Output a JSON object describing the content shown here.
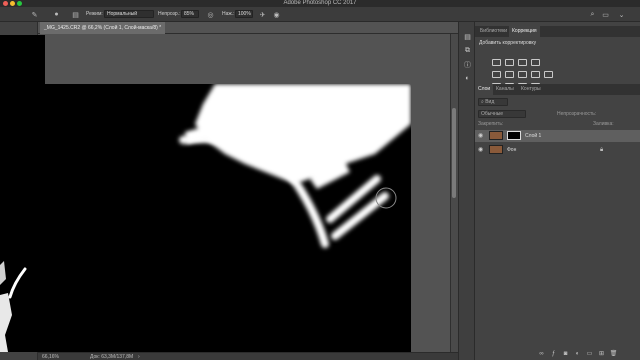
{
  "window": {
    "title": "Adobe Photoshop CC 2017"
  },
  "options_bar": {
    "mode_label": "Режим:",
    "mode_value": "Нормальный",
    "opacity_label": "Непрозр.:",
    "opacity_value": "85%",
    "flow_label": "Наж.:",
    "flow_value": "100%"
  },
  "document": {
    "tab_title": "_MG_1425.CR2 @ 66,2% (Слой 1, Слой-маска/8) *",
    "zoom": "66,16%",
    "status_doc": "Док: 63,3M/137,8M"
  },
  "panels": {
    "top_tabs": [
      "Библиотеки",
      "Коррекция"
    ],
    "adjust_title": "Добавить корректировку",
    "layer_tabs": [
      "Слои",
      "Каналы",
      "Контуры"
    ],
    "filter_kind": "Вид",
    "blend_mode": "Обычные",
    "opacity_label": "Непрозрачность:",
    "lock_label": "Закрепить:",
    "fill_label": "Заливка:",
    "layers": [
      {
        "name": "Слой 1",
        "selected": true
      },
      {
        "name": "Фон",
        "selected": false
      }
    ]
  },
  "icons": {
    "tools": [
      "move-icon",
      "marquee-icon",
      "lasso-icon",
      "quick-select-icon",
      "crop-icon",
      "eyedropper-icon",
      "healing-icon",
      "brush-icon",
      "stamp-icon",
      "history-brush-icon",
      "eraser-icon",
      "gradient-icon",
      "blur-icon",
      "dodge-icon",
      "pen-icon",
      "type-icon",
      "path-select-icon",
      "shape-icon",
      "hand-icon",
      "zoom-icon"
    ]
  }
}
